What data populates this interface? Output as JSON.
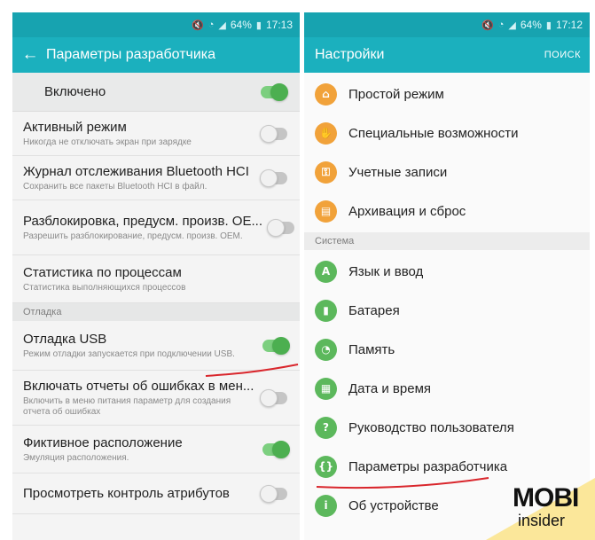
{
  "status": {
    "left_time": "17:13",
    "right_time": "17:12",
    "battery": "64%"
  },
  "left": {
    "title": "Параметры разработчика",
    "master": {
      "label": "Включено",
      "on": true
    },
    "rows1": [
      {
        "title": "Активный режим",
        "sub": "Никогда не отключать экран при зарядке",
        "on": false
      },
      {
        "title": "Журнал отслеживания Bluetooth HCI",
        "sub": "Сохранить все пакеты Bluetooth HCI в файл.",
        "on": false
      },
      {
        "title": "Разблокировка, предусм. произв. OE...",
        "sub": "Разрешить разблокирование, предусм. произв. OEM.",
        "on": false
      },
      {
        "title": "Статистика по процессам",
        "sub": "Статистика выполняющихся процессов",
        "on": null
      }
    ],
    "section": "Отладка",
    "rows2": [
      {
        "title": "Отладка USB",
        "sub": "Режим отладки запускается при подключении USB.",
        "on": true
      },
      {
        "title": "Включать отчеты об ошибках в мен...",
        "sub": "Включить в меню питания параметр для создания отчета об ошибках",
        "on": false
      },
      {
        "title": "Фиктивное расположение",
        "sub": "Эмуляция расположения.",
        "on": true
      },
      {
        "title": "Просмотреть контроль атрибутов",
        "sub": "",
        "on": false
      }
    ]
  },
  "right": {
    "title": "Настройки",
    "search": "ПОИСК",
    "items1": [
      {
        "label": "Простой режим",
        "icon": "home-icon",
        "glyph": "⌂"
      },
      {
        "label": "Специальные возможности",
        "icon": "hand-icon",
        "glyph": "✋"
      },
      {
        "label": "Учетные записи",
        "icon": "key-icon",
        "glyph": "⚿"
      },
      {
        "label": "Архивация и сброс",
        "icon": "backup-icon",
        "glyph": "▤"
      }
    ],
    "section": "Система",
    "items2": [
      {
        "label": "Язык и ввод",
        "icon": "language-icon",
        "glyph": "A"
      },
      {
        "label": "Батарея",
        "icon": "battery-icon",
        "glyph": "▮"
      },
      {
        "label": "Память",
        "icon": "storage-icon",
        "glyph": "◔"
      },
      {
        "label": "Дата и время",
        "icon": "calendar-icon",
        "glyph": "▦"
      },
      {
        "label": "Руководство пользователя",
        "icon": "manual-icon",
        "glyph": "?"
      },
      {
        "label": "Параметры разработчика",
        "icon": "developer-options-icon",
        "glyph": "{}"
      },
      {
        "label": "Об устройстве",
        "icon": "info-icon",
        "glyph": "i"
      }
    ]
  },
  "logo": {
    "top": "MOBI",
    "bottom": "insider"
  },
  "colors": {
    "appbar": "#1bb0be",
    "statusbar": "#17a3b0",
    "toggle_on": "#4caf50",
    "icon_orange": "#f1a23a",
    "icon_green": "#5cb85c",
    "underline": "#d9262c"
  }
}
